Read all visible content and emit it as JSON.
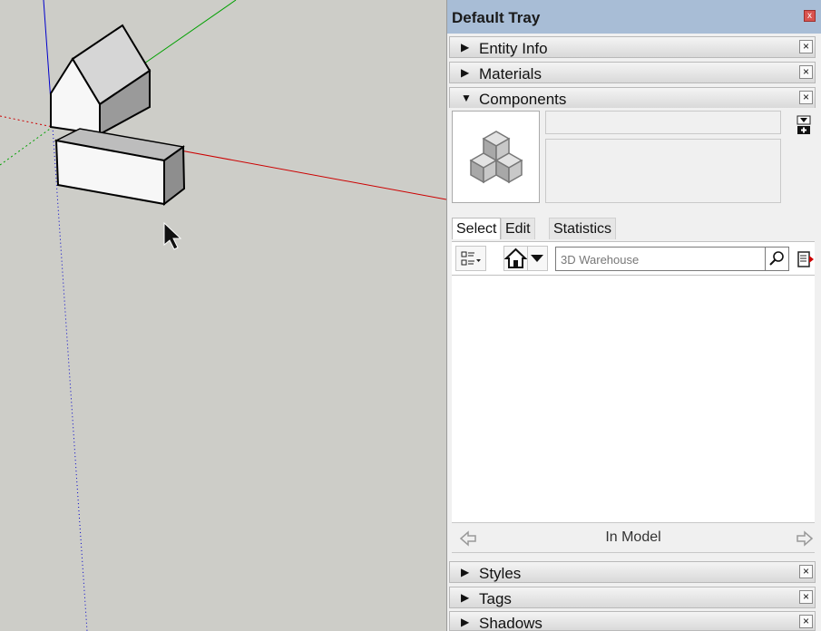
{
  "tray": {
    "title": "Default Tray",
    "close_glyph": "x"
  },
  "panels": {
    "entity_info": {
      "label": "Entity Info",
      "arrow": "▶",
      "close": "×"
    },
    "materials": {
      "label": "Materials",
      "arrow": "▶",
      "close": "×"
    },
    "components": {
      "label": "Components",
      "arrow": "▼",
      "close": "×"
    },
    "styles": {
      "label": "Styles",
      "arrow": "▶",
      "close": "×"
    },
    "tags": {
      "label": "Tags",
      "arrow": "▶",
      "close": "×"
    },
    "shadows": {
      "label": "Shadows",
      "arrow": "▶",
      "close": "×"
    }
  },
  "components": {
    "tabs": [
      "Select",
      "Edit",
      "Statistics"
    ],
    "active_tab": "Select",
    "search": {
      "placeholder": "3D Warehouse",
      "value": ""
    },
    "location_label": "In Model",
    "icons": {
      "preview": "components-cubes-icon",
      "details": "details-menu-icon",
      "view_options": "view-options-icon",
      "home": "home-icon",
      "home_dropdown": "dropdown-arrow-icon",
      "search": "magnifier-icon",
      "second_selection": "second-selection-pane-icon",
      "back": "back-arrow-icon",
      "forward": "forward-arrow-icon"
    }
  },
  "colors": {
    "tray_title_bg": "#a8bdd6",
    "axis_red": "#cc0000",
    "axis_green": "#00a000",
    "axis_blue": "#0000cc",
    "viewport_bg": "#cdcdc8"
  }
}
